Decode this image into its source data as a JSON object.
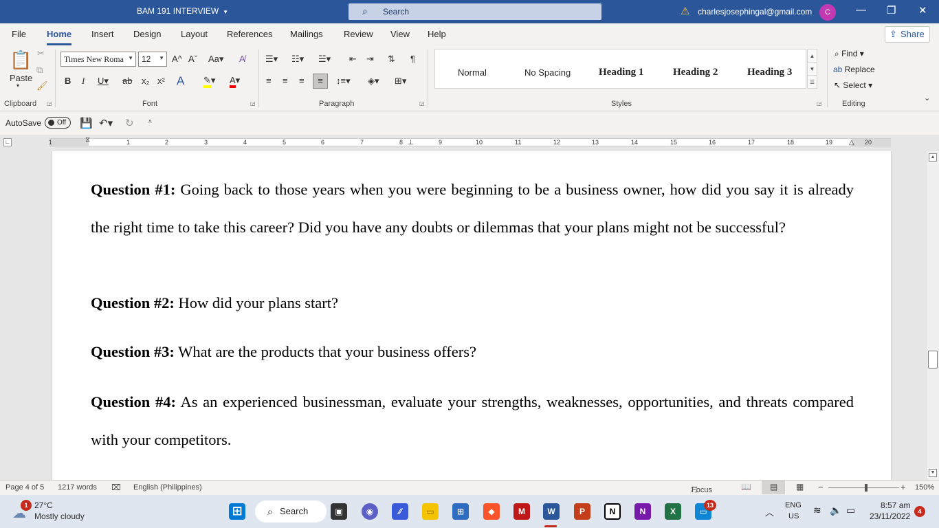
{
  "titlebar": {
    "doc_title": "BAM 191 INTERVIEW",
    "search_label": "Search",
    "account_email": "charlesjosephingal@gmail.com",
    "avatar_initial": "C",
    "minimize": "—",
    "restore": "❐",
    "close": "✕"
  },
  "menu": {
    "tabs": [
      "File",
      "Home",
      "Insert",
      "Design",
      "Layout",
      "References",
      "Mailings",
      "Review",
      "View",
      "Help"
    ],
    "active": "Home",
    "share_label": "Share"
  },
  "ribbon": {
    "clipboard": {
      "label": "Clipboard",
      "paste_label": "Paste"
    },
    "font": {
      "label": "Font",
      "family": "Times New Roma",
      "size": "12"
    },
    "paragraph": {
      "label": "Paragraph"
    },
    "styles": {
      "label": "Styles",
      "items": [
        "Normal",
        "No Spacing",
        "Heading 1",
        "Heading 2",
        "Heading 3"
      ]
    },
    "editing": {
      "label": "Editing",
      "find": "Find",
      "replace": "Replace",
      "select": "Select"
    }
  },
  "qat": {
    "autosave_label": "AutoSave",
    "autosave_state": "Off"
  },
  "ruler": {
    "numbers": [
      "1",
      "1",
      "2",
      "3",
      "4",
      "5",
      "6",
      "7",
      "8",
      "9",
      "10",
      "11",
      "12",
      "13",
      "14",
      "15",
      "16",
      "17",
      "18",
      "19",
      "20"
    ]
  },
  "document": {
    "questions": [
      {
        "label": "Question #1:",
        "text": " Going back to those years when you were beginning to be a business owner, how did you say it is already the right time to take this career? Did you have any doubts or dilemmas that your plans might not be successful?"
      },
      {
        "label": "Question #2:",
        "text": " How did your plans start?"
      },
      {
        "label": "Question #3:",
        "text": " What are the products that your business offers?"
      },
      {
        "label": "Question #4:",
        "text": " As an experienced businessman, evaluate your strengths, weaknesses, opportunities, and threats compared with your competitors."
      }
    ]
  },
  "statusbar": {
    "page": "Page 4 of 5",
    "words": "1217 words",
    "language": "English (Philippines)",
    "focus": "Focus",
    "zoom": "150%"
  },
  "taskbar": {
    "weather_temp": "27°C",
    "weather_desc": "Mostly cloudy",
    "weather_badge": "1",
    "search_label": "Search",
    "teams_badge": "13",
    "lang_top": "ENG",
    "lang_bottom": "US",
    "time": "8:57 am",
    "date": "23/11/2022",
    "notif_count": "4"
  },
  "colors": {
    "word_blue": "#2b579a",
    "avatar": "#c239b3",
    "badge_red": "#c42b1c"
  }
}
